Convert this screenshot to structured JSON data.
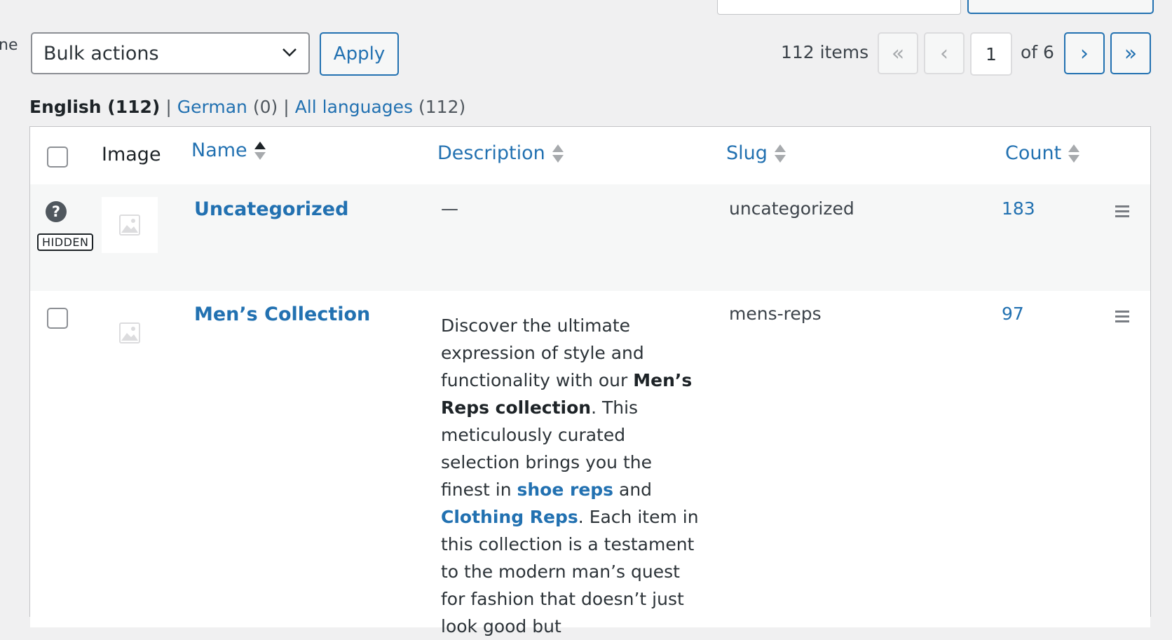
{
  "edge_text": "ne",
  "bulk": {
    "selected": "Bulk actions",
    "apply_label": "Apply"
  },
  "pagination": {
    "items_count": "112 items",
    "first": "«",
    "prev": "‹",
    "current_page": "1",
    "of_label": "of 6",
    "next": "›",
    "last": "»"
  },
  "languages": {
    "current": "English (112)",
    "sep": "|",
    "german_label": "German",
    "german_count": "(0)",
    "all_label": "All languages",
    "all_count": "(112)"
  },
  "table": {
    "columns": {
      "image": "Image",
      "name": "Name",
      "description": "Description",
      "slug": "Slug",
      "count": "Count"
    },
    "rows": [
      {
        "name": "Uncategorized",
        "description": "—",
        "slug": "uncategorized",
        "count": "183",
        "help": "?",
        "badge": "HIDDEN"
      },
      {
        "name": "Men’s Collection",
        "slug": "mens-reps",
        "count": "97",
        "description": {
          "p1": "Discover the ultimate expression of style and functionality with our ",
          "b1": "Men’s Reps collection",
          "p2": ". This meticulously curated selection brings you the finest in ",
          "link1": "shoe reps",
          "p3": " and ",
          "link2": "Clothing Reps",
          "p4": ". Each item in this collection is a testament to the modern man’s quest for fashion that doesn’t just look good but"
        }
      }
    ]
  },
  "colors": {
    "accent": "#2271b1",
    "row_alt": "#f6f7f7",
    "border": "#c3c4c7"
  }
}
